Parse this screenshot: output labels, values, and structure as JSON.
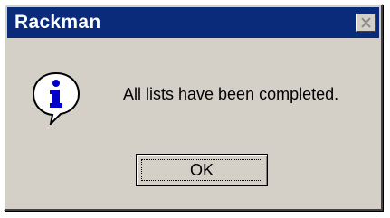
{
  "window": {
    "title": "Rackman",
    "title_bar_color": "#0a2a7a",
    "face_color": "#d4d0c8"
  },
  "icons": {
    "message_icon": "information-icon",
    "close_icon": "close-icon"
  },
  "message": "All lists have been completed.",
  "buttons": {
    "ok_label": "OK"
  }
}
